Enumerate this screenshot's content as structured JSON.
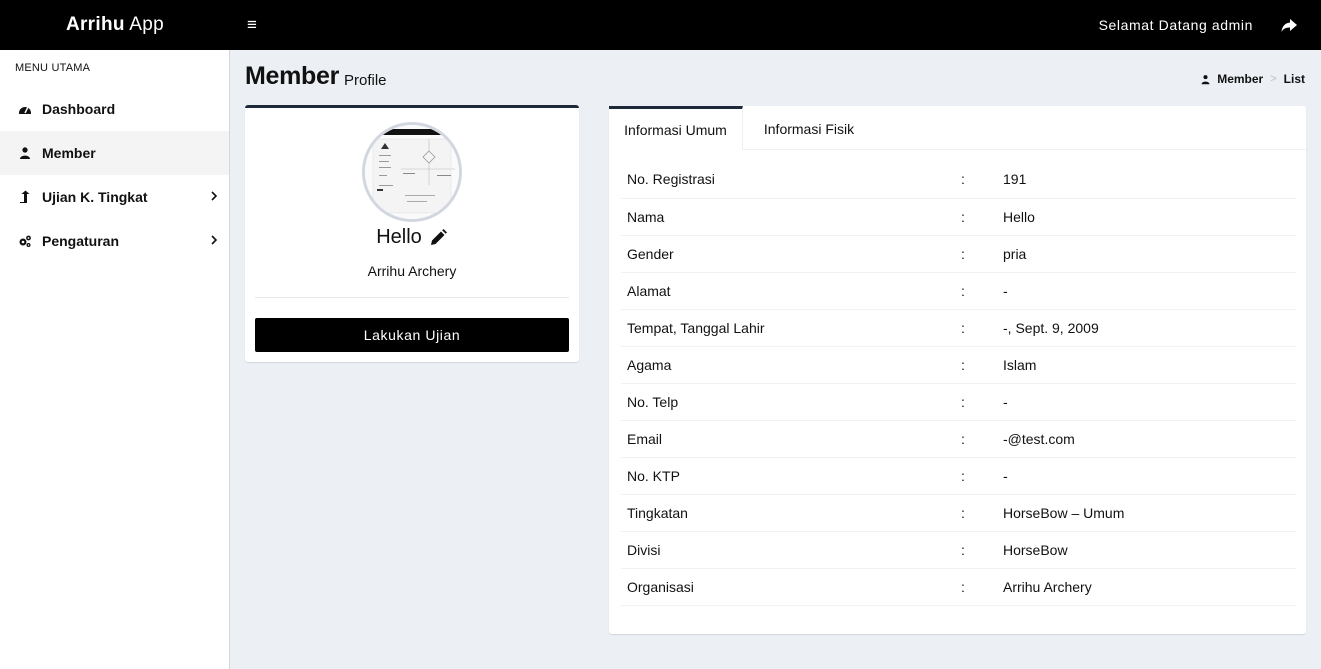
{
  "header": {
    "brand_bold": "Arrihu",
    "brand_light": " App",
    "menu_icon": "≡",
    "welcome_text": "Selamat Datang  admin",
    "logout_icon": "share-icon"
  },
  "sidebar": {
    "menu_header": "MENU UTAMA",
    "items": [
      {
        "label": "Dashboard",
        "icon": "dashboard-icon",
        "active": false
      },
      {
        "label": "Member",
        "icon": "user-icon",
        "active": true
      },
      {
        "label": "Ujian K. Tingkat",
        "icon": "level-up-icon",
        "active": false,
        "has_submenu": true
      },
      {
        "label": "Pengaturan",
        "icon": "cogs-icon",
        "active": false,
        "has_submenu": true
      }
    ]
  },
  "content_header": {
    "title": "Member",
    "subtitle": "Profile",
    "breadcrumb": {
      "link": "Member",
      "separator": ">",
      "active": "List"
    }
  },
  "profile": {
    "name": "Hello",
    "organization": "Arrihu Archery",
    "action_button": "Lakukan Ujian"
  },
  "tabs": [
    {
      "label": "Informasi Umum",
      "active": true
    },
    {
      "label": "Informasi Fisik",
      "active": false
    }
  ],
  "info": {
    "separator": ":",
    "rows": [
      {
        "key": "No. Registrasi",
        "value": "191"
      },
      {
        "key": "Nama",
        "value": "Hello"
      },
      {
        "key": "Gender",
        "value": "pria"
      },
      {
        "key": "Alamat",
        "value": "-"
      },
      {
        "key": "Tempat, Tanggal Lahir",
        "value": "-, Sept. 9, 2009"
      },
      {
        "key": "Agama",
        "value": "Islam"
      },
      {
        "key": "No. Telp",
        "value": "-"
      },
      {
        "key": "Email",
        "value": "-@test.com"
      },
      {
        "key": "No. KTP",
        "value": "-"
      },
      {
        "key": "Tingkatan",
        "value": "HorseBow – Umum"
      },
      {
        "key": "Divisi",
        "value": "HorseBow"
      },
      {
        "key": "Organisasi",
        "value": "Arrihu Archery"
      }
    ]
  },
  "colors": {
    "header_bg": "#000000",
    "sidebar_bg": "#ffffff",
    "content_bg": "#ecf0f5",
    "accent": "#1e2a3a",
    "button_bg": "#000000"
  }
}
